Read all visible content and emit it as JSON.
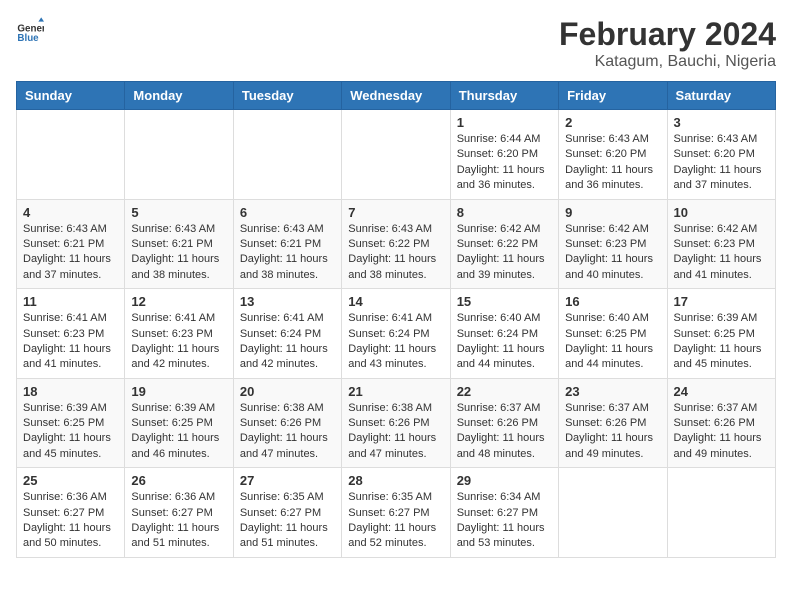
{
  "header": {
    "logo_general": "General",
    "logo_blue": "Blue",
    "month_year": "February 2024",
    "location": "Katagum, Bauchi, Nigeria"
  },
  "days_of_week": [
    "Sunday",
    "Monday",
    "Tuesday",
    "Wednesday",
    "Thursday",
    "Friday",
    "Saturday"
  ],
  "weeks": [
    [
      {
        "day": "",
        "sunrise": "",
        "sunset": "",
        "daylight": ""
      },
      {
        "day": "",
        "sunrise": "",
        "sunset": "",
        "daylight": ""
      },
      {
        "day": "",
        "sunrise": "",
        "sunset": "",
        "daylight": ""
      },
      {
        "day": "",
        "sunrise": "",
        "sunset": "",
        "daylight": ""
      },
      {
        "day": "1",
        "sunrise": "Sunrise: 6:44 AM",
        "sunset": "Sunset: 6:20 PM",
        "daylight": "Daylight: 11 hours and 36 minutes."
      },
      {
        "day": "2",
        "sunrise": "Sunrise: 6:43 AM",
        "sunset": "Sunset: 6:20 PM",
        "daylight": "Daylight: 11 hours and 36 minutes."
      },
      {
        "day": "3",
        "sunrise": "Sunrise: 6:43 AM",
        "sunset": "Sunset: 6:20 PM",
        "daylight": "Daylight: 11 hours and 37 minutes."
      }
    ],
    [
      {
        "day": "4",
        "sunrise": "Sunrise: 6:43 AM",
        "sunset": "Sunset: 6:21 PM",
        "daylight": "Daylight: 11 hours and 37 minutes."
      },
      {
        "day": "5",
        "sunrise": "Sunrise: 6:43 AM",
        "sunset": "Sunset: 6:21 PM",
        "daylight": "Daylight: 11 hours and 38 minutes."
      },
      {
        "day": "6",
        "sunrise": "Sunrise: 6:43 AM",
        "sunset": "Sunset: 6:21 PM",
        "daylight": "Daylight: 11 hours and 38 minutes."
      },
      {
        "day": "7",
        "sunrise": "Sunrise: 6:43 AM",
        "sunset": "Sunset: 6:22 PM",
        "daylight": "Daylight: 11 hours and 38 minutes."
      },
      {
        "day": "8",
        "sunrise": "Sunrise: 6:42 AM",
        "sunset": "Sunset: 6:22 PM",
        "daylight": "Daylight: 11 hours and 39 minutes."
      },
      {
        "day": "9",
        "sunrise": "Sunrise: 6:42 AM",
        "sunset": "Sunset: 6:23 PM",
        "daylight": "Daylight: 11 hours and 40 minutes."
      },
      {
        "day": "10",
        "sunrise": "Sunrise: 6:42 AM",
        "sunset": "Sunset: 6:23 PM",
        "daylight": "Daylight: 11 hours and 41 minutes."
      }
    ],
    [
      {
        "day": "11",
        "sunrise": "Sunrise: 6:41 AM",
        "sunset": "Sunset: 6:23 PM",
        "daylight": "Daylight: 11 hours and 41 minutes."
      },
      {
        "day": "12",
        "sunrise": "Sunrise: 6:41 AM",
        "sunset": "Sunset: 6:23 PM",
        "daylight": "Daylight: 11 hours and 42 minutes."
      },
      {
        "day": "13",
        "sunrise": "Sunrise: 6:41 AM",
        "sunset": "Sunset: 6:24 PM",
        "daylight": "Daylight: 11 hours and 42 minutes."
      },
      {
        "day": "14",
        "sunrise": "Sunrise: 6:41 AM",
        "sunset": "Sunset: 6:24 PM",
        "daylight": "Daylight: 11 hours and 43 minutes."
      },
      {
        "day": "15",
        "sunrise": "Sunrise: 6:40 AM",
        "sunset": "Sunset: 6:24 PM",
        "daylight": "Daylight: 11 hours and 44 minutes."
      },
      {
        "day": "16",
        "sunrise": "Sunrise: 6:40 AM",
        "sunset": "Sunset: 6:25 PM",
        "daylight": "Daylight: 11 hours and 44 minutes."
      },
      {
        "day": "17",
        "sunrise": "Sunrise: 6:39 AM",
        "sunset": "Sunset: 6:25 PM",
        "daylight": "Daylight: 11 hours and 45 minutes."
      }
    ],
    [
      {
        "day": "18",
        "sunrise": "Sunrise: 6:39 AM",
        "sunset": "Sunset: 6:25 PM",
        "daylight": "Daylight: 11 hours and 45 minutes."
      },
      {
        "day": "19",
        "sunrise": "Sunrise: 6:39 AM",
        "sunset": "Sunset: 6:25 PM",
        "daylight": "Daylight: 11 hours and 46 minutes."
      },
      {
        "day": "20",
        "sunrise": "Sunrise: 6:38 AM",
        "sunset": "Sunset: 6:26 PM",
        "daylight": "Daylight: 11 hours and 47 minutes."
      },
      {
        "day": "21",
        "sunrise": "Sunrise: 6:38 AM",
        "sunset": "Sunset: 6:26 PM",
        "daylight": "Daylight: 11 hours and 47 minutes."
      },
      {
        "day": "22",
        "sunrise": "Sunrise: 6:37 AM",
        "sunset": "Sunset: 6:26 PM",
        "daylight": "Daylight: 11 hours and 48 minutes."
      },
      {
        "day": "23",
        "sunrise": "Sunrise: 6:37 AM",
        "sunset": "Sunset: 6:26 PM",
        "daylight": "Daylight: 11 hours and 49 minutes."
      },
      {
        "day": "24",
        "sunrise": "Sunrise: 6:37 AM",
        "sunset": "Sunset: 6:26 PM",
        "daylight": "Daylight: 11 hours and 49 minutes."
      }
    ],
    [
      {
        "day": "25",
        "sunrise": "Sunrise: 6:36 AM",
        "sunset": "Sunset: 6:27 PM",
        "daylight": "Daylight: 11 hours and 50 minutes."
      },
      {
        "day": "26",
        "sunrise": "Sunrise: 6:36 AM",
        "sunset": "Sunset: 6:27 PM",
        "daylight": "Daylight: 11 hours and 51 minutes."
      },
      {
        "day": "27",
        "sunrise": "Sunrise: 6:35 AM",
        "sunset": "Sunset: 6:27 PM",
        "daylight": "Daylight: 11 hours and 51 minutes."
      },
      {
        "day": "28",
        "sunrise": "Sunrise: 6:35 AM",
        "sunset": "Sunset: 6:27 PM",
        "daylight": "Daylight: 11 hours and 52 minutes."
      },
      {
        "day": "29",
        "sunrise": "Sunrise: 6:34 AM",
        "sunset": "Sunset: 6:27 PM",
        "daylight": "Daylight: 11 hours and 53 minutes."
      },
      {
        "day": "",
        "sunrise": "",
        "sunset": "",
        "daylight": ""
      },
      {
        "day": "",
        "sunrise": "",
        "sunset": "",
        "daylight": ""
      }
    ]
  ]
}
